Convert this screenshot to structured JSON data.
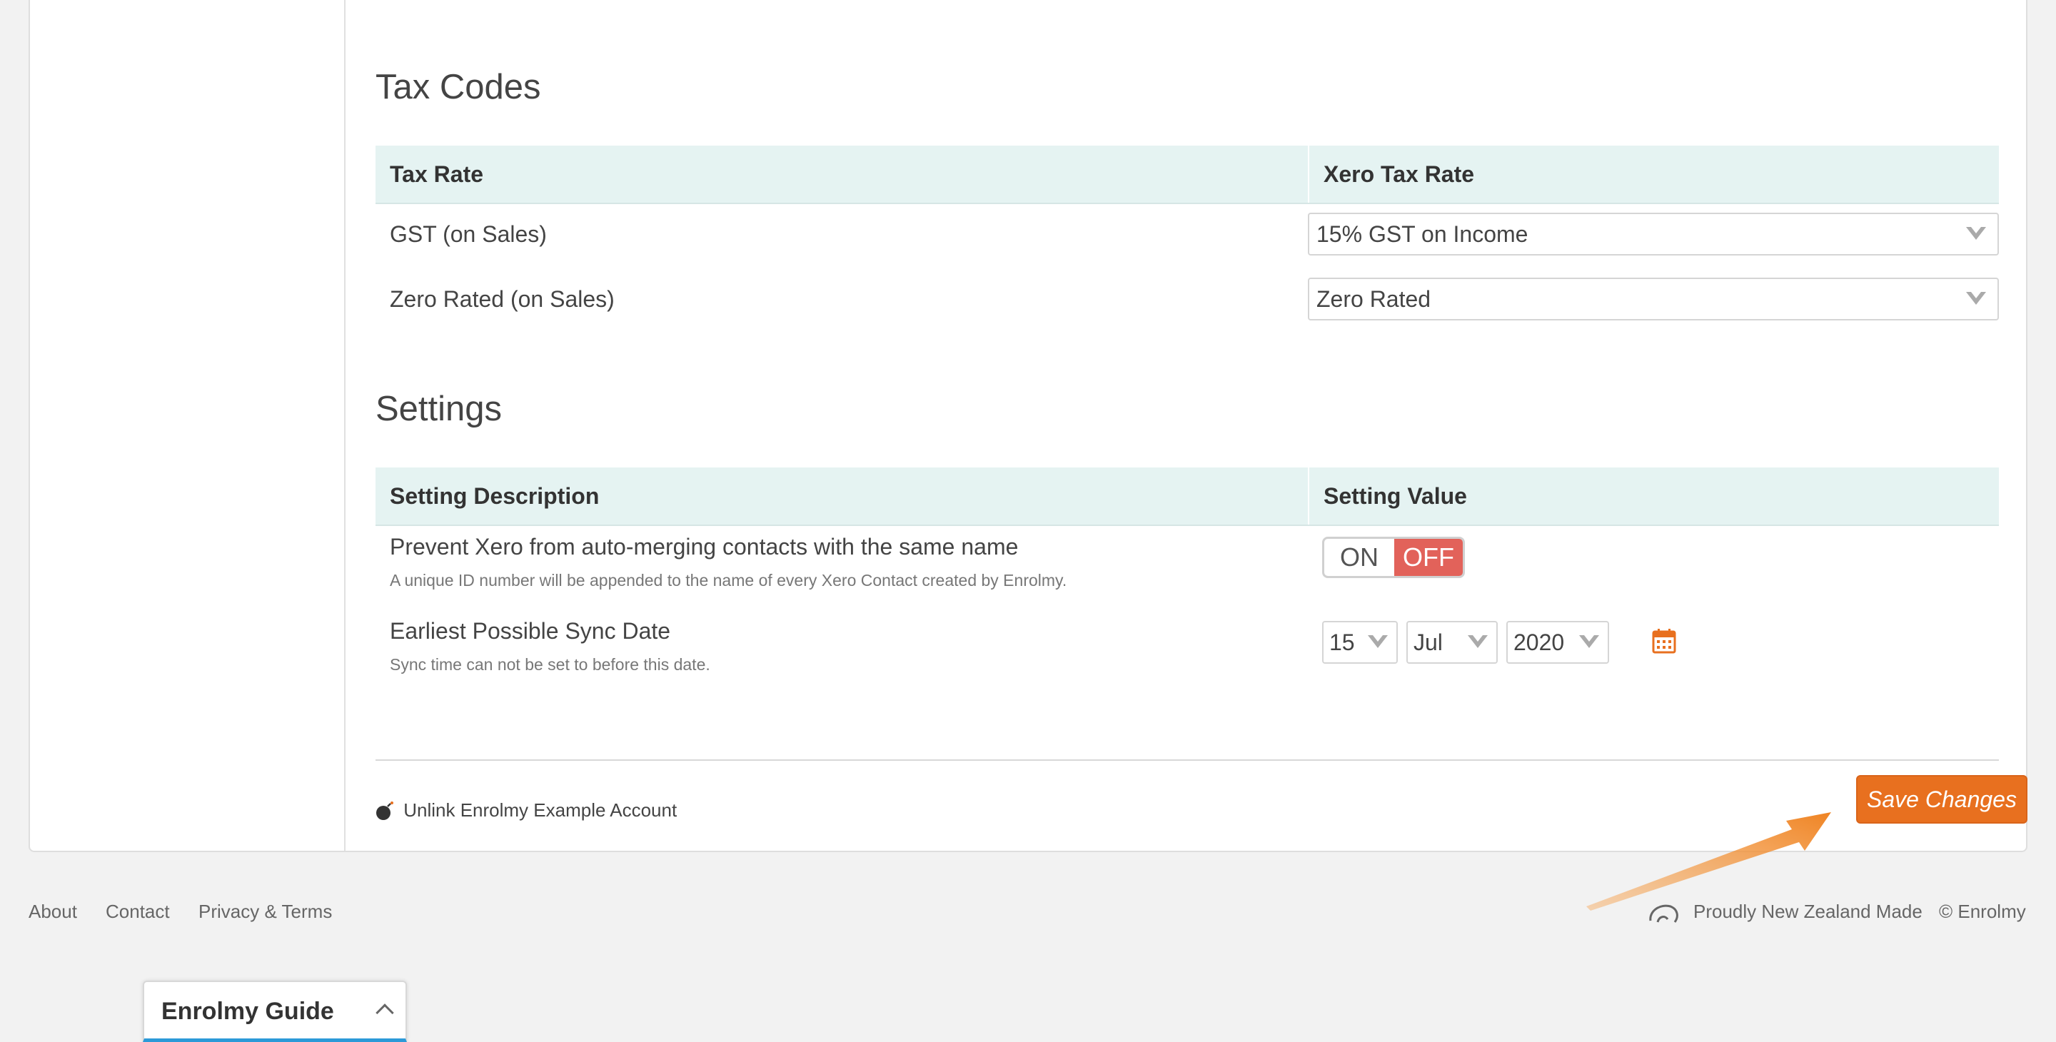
{
  "tax_codes": {
    "title": "Tax Codes",
    "headers": [
      "Tax Rate",
      "Xero Tax Rate"
    ],
    "rows": [
      {
        "label": "GST (on Sales)",
        "value": "15% GST on Income"
      },
      {
        "label": "Zero Rated (on Sales)",
        "value": "Zero Rated"
      }
    ]
  },
  "settings": {
    "title": "Settings",
    "headers": [
      "Setting Description",
      "Setting Value"
    ],
    "rows": [
      {
        "label": "Prevent Xero from auto-merging contacts with the same name",
        "sub": "A unique ID number will be appended to the name of every Xero Contact created by Enrolmy.",
        "toggle_on": "ON",
        "toggle_off": "OFF",
        "toggle_state": "OFF"
      },
      {
        "label": "Earliest Possible Sync Date",
        "sub": "Sync time can not be set to before this date.",
        "day": "15",
        "month": "Jul",
        "year": "2020"
      }
    ]
  },
  "actions": {
    "unlink": "Unlink Enrolmy Example Account",
    "save": "Save Changes"
  },
  "footer": {
    "links": [
      "About",
      "Contact",
      "Privacy & Terms"
    ],
    "made_in": "Proudly New Zealand Made",
    "copyright": "© Enrolmy"
  },
  "guide": {
    "title": "Enrolmy Guide"
  },
  "colors": {
    "accent_orange": "#e8701f",
    "toggle_off_red": "#e2625a",
    "table_header_bg": "#e5f3f2",
    "guide_underline": "#2c9ad8"
  }
}
